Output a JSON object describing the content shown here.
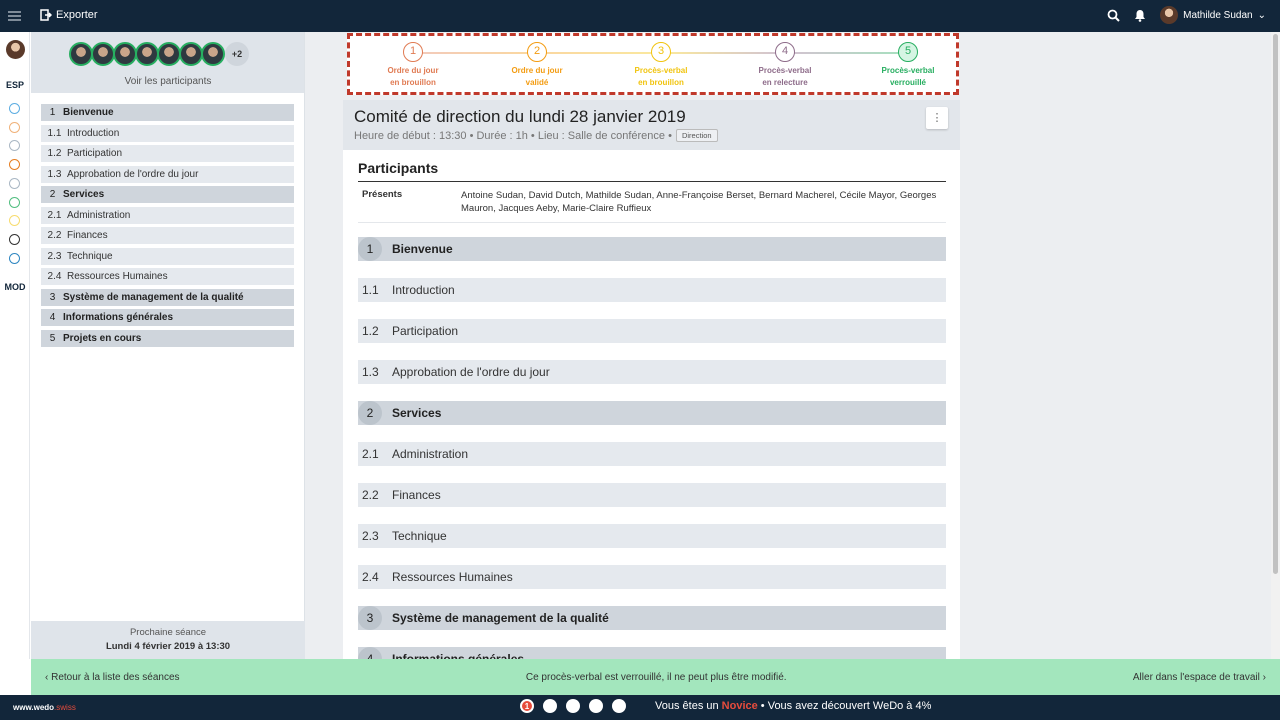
{
  "topbar": {
    "export_label": "Exporter",
    "user_name": "Mathilde Sudan"
  },
  "rail": {
    "esp": "ESP",
    "mod": "MOD",
    "dots": [
      "#5dade2",
      "#f0b27a",
      "#aab7c4",
      "#e67e22",
      "#aab7c4",
      "#52be80",
      "#f7dc6f",
      "#333333",
      "#2e86c1"
    ]
  },
  "sidebar": {
    "more_count": "+2",
    "view_participants": "Voir les participants",
    "items": [
      {
        "num": "1",
        "label": "Bienvenue",
        "section": true
      },
      {
        "num": "1.1",
        "label": "Introduction",
        "section": false
      },
      {
        "num": "1.2",
        "label": "Participation",
        "section": false
      },
      {
        "num": "1.3",
        "label": "Approbation de l'ordre du jour",
        "section": false
      },
      {
        "num": "2",
        "label": "Services",
        "section": true
      },
      {
        "num": "2.1",
        "label": "Administration",
        "section": false
      },
      {
        "num": "2.2",
        "label": "Finances",
        "section": false
      },
      {
        "num": "2.3",
        "label": "Technique",
        "section": false
      },
      {
        "num": "2.4",
        "label": "Ressources Humaines",
        "section": false
      },
      {
        "num": "3",
        "label": "Système de management de la qualité",
        "section": true
      },
      {
        "num": "4",
        "label": "Informations générales",
        "section": true
      },
      {
        "num": "5",
        "label": "Projets en cours",
        "section": true
      }
    ],
    "next_label": "Prochaine séance",
    "next_date": "Lundi 4 février 2019 à 13:30"
  },
  "steps": [
    {
      "num": "1",
      "line1": "Ordre du jour",
      "line2": "en brouillon",
      "color": "#e07b53"
    },
    {
      "num": "2",
      "line1": "Ordre du jour",
      "line2": "validé",
      "color": "#f39c12"
    },
    {
      "num": "3",
      "line1": "Procès-verbal",
      "line2": "en brouillon",
      "color": "#f1c40f"
    },
    {
      "num": "4",
      "line1": "Procès-verbal",
      "line2": "en relecture",
      "color": "#8e6c8a"
    },
    {
      "num": "5",
      "line1": "Procès-verbal",
      "line2": "verrouillé",
      "color": "#27ae60"
    }
  ],
  "meeting": {
    "title": "Comité de direction du lundi 28 janvier 2019",
    "subtitle": "Heure de début : 13:30 • Durée : 1h • Lieu : Salle de conférence •",
    "tag": "Direction",
    "kebab": "⋮"
  },
  "participants": {
    "heading": "Participants",
    "present_label": "Présents",
    "present_value": "Antoine Sudan, David Dutch, Mathilde Sudan, Anne-Françoise Berset, Bernard Macherel, Cécile Mayor, Georges Mauron, Jacques Aeby, Marie-Claire Ruffieux"
  },
  "agenda": [
    {
      "num": "1",
      "label": "Bienvenue",
      "section": true
    },
    {
      "num": "1.1",
      "label": "Introduction",
      "section": false
    },
    {
      "num": "1.2",
      "label": "Participation",
      "section": false
    },
    {
      "num": "1.3",
      "label": "Approbation de l'ordre du jour",
      "section": false
    },
    {
      "num": "2",
      "label": "Services",
      "section": true
    },
    {
      "num": "2.1",
      "label": "Administration",
      "section": false
    },
    {
      "num": "2.2",
      "label": "Finances",
      "section": false
    },
    {
      "num": "2.3",
      "label": "Technique",
      "section": false
    },
    {
      "num": "2.4",
      "label": "Ressources Humaines",
      "section": false
    },
    {
      "num": "3",
      "label": "Système de management de la qualité",
      "section": true
    },
    {
      "num": "4",
      "label": "Informations générales",
      "section": true
    }
  ],
  "banner": {
    "back": "‹ Retour à la liste des séances",
    "message": "Ce procès-verbal est verrouillé, il ne peut plus être modifié.",
    "go": "Aller dans l'espace de travail ›"
  },
  "footer": {
    "site_a": "www.wedo",
    "site_b": ".swiss",
    "active_step": "1",
    "text_a": "Vous êtes un ",
    "level": "Novice",
    "text_b": " • Vous avez découvert WeDo à 4%"
  }
}
